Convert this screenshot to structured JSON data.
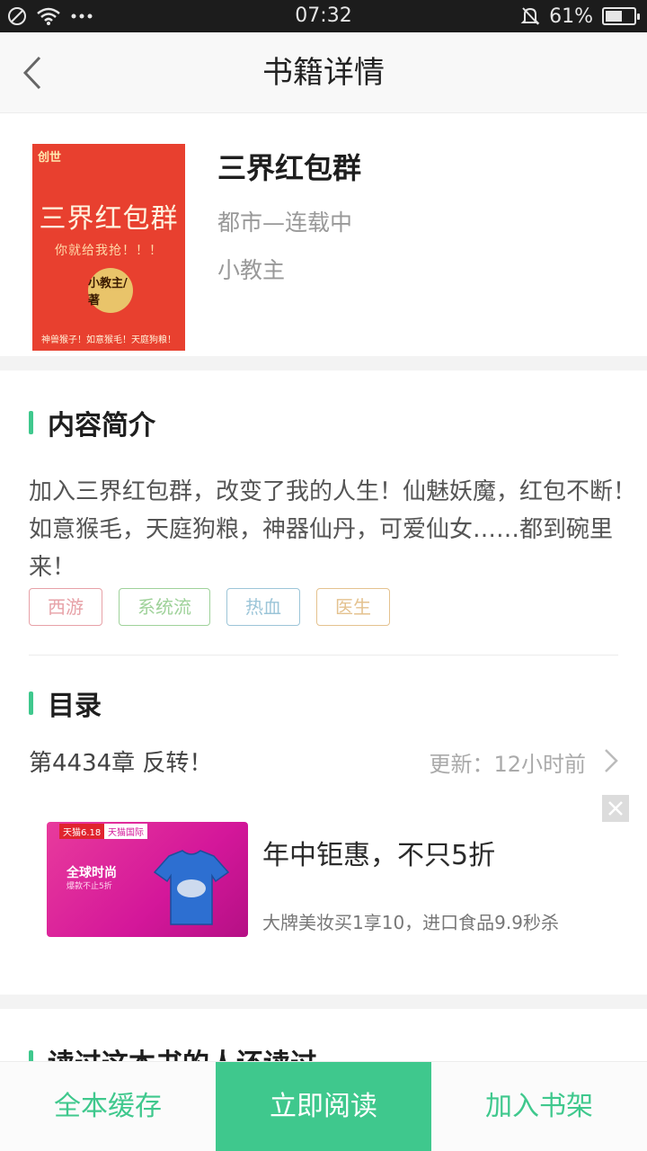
{
  "status_bar": {
    "time": "07:32",
    "battery_text": "61%",
    "battery_level": 0.61,
    "icons": [
      "no-sim-icon",
      "wifi-icon",
      "more-dots-icon",
      "bell-muted-icon",
      "battery-icon"
    ]
  },
  "nav": {
    "title": "书籍详情",
    "back_icon": "chevron-left-icon"
  },
  "book": {
    "title": "三界红包群",
    "category_status": "都市—连载中",
    "author": "小教主",
    "cover": {
      "title": "三界红包群",
      "subtitle": "你就给我抢！！！",
      "seal": "小教主/著",
      "brand": "创世",
      "footer": "神兽猴子！如意猴毛！天庭狗粮！",
      "color": "#e8402f"
    }
  },
  "intro_section": {
    "heading": "内容简介",
    "text": "加入三界红包群，改变了我的人生！仙魅妖魔，红包不断！如意猴毛，天庭狗粮，神器仙丹，可爱仙女……都到碗里来！",
    "tags": [
      {
        "label": "西游",
        "color": "#e7a1a7"
      },
      {
        "label": "系统流",
        "color": "#9fd29a"
      },
      {
        "label": "热血",
        "color": "#9cc5d8"
      },
      {
        "label": "医生",
        "color": "#e4c28f"
      }
    ]
  },
  "toc_section": {
    "heading": "目录",
    "latest_chapter": "第4434章 反转！",
    "update_text": "更新：12小时前"
  },
  "ad": {
    "title": "年中钜惠，不只5折",
    "description": "大牌美妆买1享10，进口食品9.9秒杀",
    "image_text_main": "全球时尚",
    "image_text_sub": "爆款不止5折",
    "badge1": "天猫6.18",
    "badge2": "天猫国际"
  },
  "next_section_heading": "读过这本书的人还读过",
  "bottom_bar": {
    "cache_label": "全本缓存",
    "read_label": "立即阅读",
    "shelf_label": "加入书架"
  },
  "colors": {
    "accent": "#3fc88d",
    "status_bar_bg": "#1c1c1c"
  }
}
